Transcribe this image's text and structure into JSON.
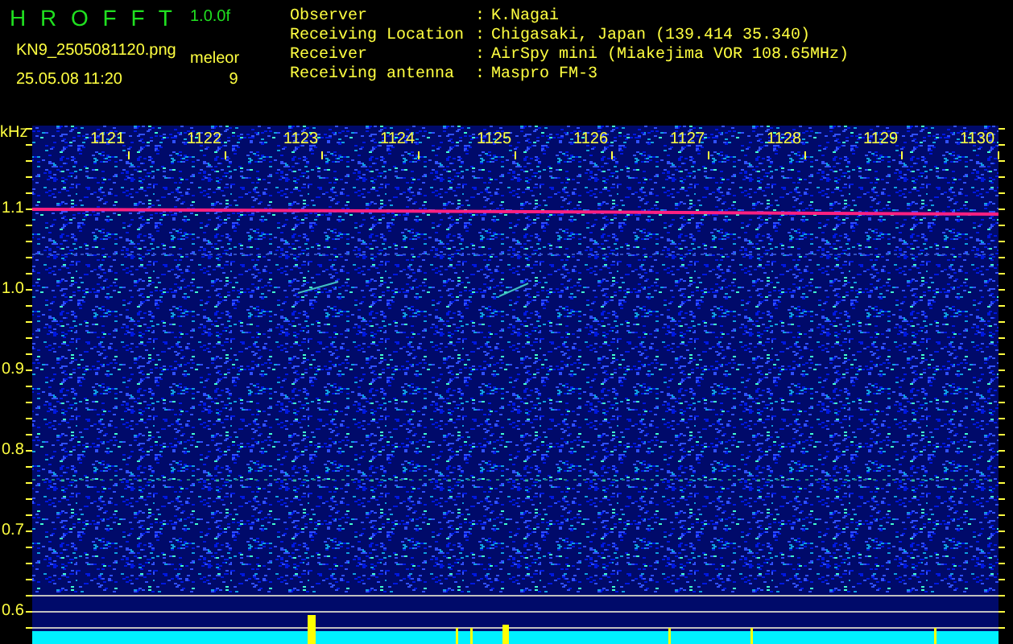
{
  "header": {
    "title": "H R O F F T",
    "version": "1.0.0f",
    "filename": "KN9_2505081120.png",
    "timestamp": "25.05.08 11:20",
    "mode": "meleor",
    "count": "9",
    "info": [
      {
        "label": "Observer",
        "separator": ":",
        "value": "K.Nagai"
      },
      {
        "label": "Receiving Location",
        "separator": ":",
        "value": "Chigasaki, Japan (139.414 35.340)"
      },
      {
        "label": "Receiver",
        "separator": ":",
        "value": "AirSpy mini (Miakejima VOR 108.65MHz)"
      },
      {
        "label": "Receiving antenna",
        "separator": ":",
        "value": "Maspro FM-3"
      }
    ]
  },
  "spectrogram": {
    "y_unit": "kHz",
    "y_ticks": [
      "1.1",
      "1.0",
      "0.9",
      "0.8",
      "0.7",
      "0.6"
    ],
    "time_labels": [
      "1121",
      "1122",
      "1123",
      "1124",
      "1125",
      "1126",
      "1127",
      "1128",
      "1129",
      "1130"
    ]
  }
}
